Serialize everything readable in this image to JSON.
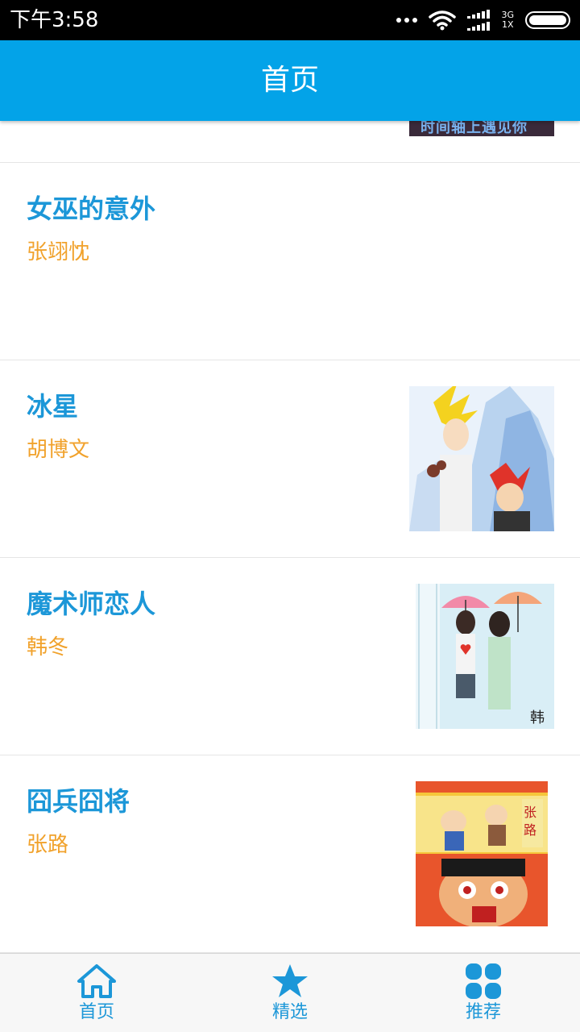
{
  "status_bar": {
    "time": "下午3:58",
    "network_top": "3G",
    "network_bottom": "1X"
  },
  "header": {
    "title": "首页"
  },
  "partial_item": {
    "cover_text": "时间轴上遇见你"
  },
  "items": [
    {
      "title": "女巫的意外",
      "author": "张翊忱"
    },
    {
      "title": "冰星",
      "author": "胡博文"
    },
    {
      "title": "魔术师恋人",
      "author": "韩冬"
    },
    {
      "title": "囧兵囧将",
      "author": "张路"
    }
  ],
  "bottom_nav": {
    "tabs": [
      {
        "label": "首页",
        "icon": "home-icon"
      },
      {
        "label": "精选",
        "icon": "star-icon"
      },
      {
        "label": "推荐",
        "icon": "grid-icon"
      }
    ]
  },
  "colors": {
    "brand": "#03A3E8",
    "title": "#1C97D8",
    "author": "#F1A22C"
  }
}
